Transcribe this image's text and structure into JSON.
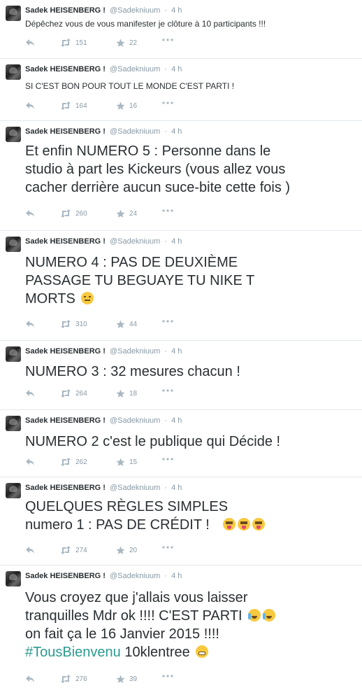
{
  "tweets": [
    {
      "name": "Sadek HEISENBERG !",
      "handle": "@Sadekniuum",
      "time": "4 h",
      "lines": [
        "Dépêchez vous de vous manifester je clôture à 10 participants !!!"
      ],
      "retweets": "151",
      "favorites": "22"
    },
    {
      "name": "Sadek HEISENBERG !",
      "handle": "@Sadekniuum",
      "time": "4 h",
      "lines": [
        "SI C'EST BON POUR TOUT LE MONDE C'EST PARTI !"
      ],
      "retweets": "164",
      "favorites": "16"
    },
    {
      "name": "Sadek HEISENBERG !",
      "handle": "@Sadekniuum",
      "time": "4 h",
      "lines": [
        "Et enfin NUMERO 5 : Personne dans le",
        "studio à part les Kickeurs (vous allez vous",
        "cacher derrière aucun suce-bite cette fois )"
      ],
      "retweets": "260",
      "favorites": "24"
    },
    {
      "name": "Sadek HEISENBERG !",
      "handle": "@Sadekniuum",
      "time": "4 h",
      "lines": [
        "NUMERO 4 : PAS DE DEUXIÈME",
        "PASSAGE TU BEGUAYE TU NIKE T",
        "MORTS"
      ],
      "retweets": "310",
      "favorites": "44"
    },
    {
      "name": "Sadek HEISENBERG !",
      "handle": "@Sadekniuum",
      "time": "4 h",
      "lines": [
        "NUMERO 3 : 32 mesures chacun !"
      ],
      "retweets": "264",
      "favorites": "18"
    },
    {
      "name": "Sadek HEISENBERG !",
      "handle": "@Sadekniuum",
      "time": "4 h",
      "lines": [
        "NUMERO 2 c'est le publique qui Décide !"
      ],
      "retweets": "262",
      "favorites": "15"
    },
    {
      "name": "Sadek HEISENBERG !",
      "handle": "@Sadekniuum",
      "time": "4 h",
      "lines": [
        "QUELQUES RÈGLES SIMPLES",
        "numero 1 : PAS DE CRÉDIT !"
      ],
      "retweets": "274",
      "favorites": "20"
    },
    {
      "name": "Sadek HEISENBERG !",
      "handle": "@Sadekniuum",
      "time": "4 h",
      "lines": [
        "Vous croyez que j'allais vous laisser",
        "tranquilles Mdr  ok !!!! C'EST PARTI",
        "on fait ça le 16 Janvier 2015 !!!!"
      ],
      "hashtag": "#TousBienvenu",
      "after_hashtag": " 10klentree",
      "retweets": "276",
      "favorites": "39"
    }
  ],
  "icons": {
    "reply": "reply-arrow-icon",
    "retweet": "retweet-icon",
    "favorite": "star-icon",
    "more": "more-dots-icon"
  },
  "colors": {
    "text": "#292f33",
    "meta": "#8899a6",
    "hashtag": "#2b9b8f",
    "divider": "#e1e8ed"
  }
}
